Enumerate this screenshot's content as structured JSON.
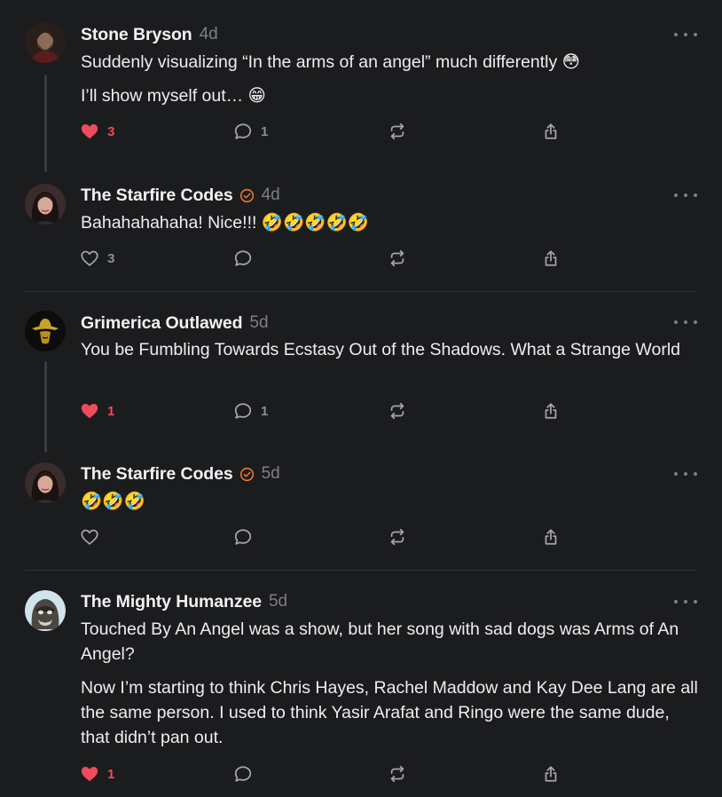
{
  "posts": [
    {
      "author": "Stone Bryson",
      "time": "4d",
      "verified": false,
      "paragraphs": [
        "Suddenly visualizing “In the arms of an angel” much differently 😳",
        "I’ll show myself out… 😁"
      ],
      "likes": "3",
      "liked": true,
      "comments": "1",
      "avatar_icon": "bearded-man-avatar"
    },
    {
      "author": "The Starfire Codes",
      "time": "4d",
      "verified": true,
      "paragraphs": [
        "Bahahahahaha! Nice!!! 🤣🤣🤣🤣🤣"
      ],
      "likes": "3",
      "liked": false,
      "comments": "",
      "avatar_icon": "woman-avatar"
    },
    {
      "author": "Grimerica Outlawed",
      "time": "5d",
      "verified": false,
      "paragraphs": [
        "You be Fumbling Towards Ecstasy Out of the Shadows. What a Strange World"
      ],
      "likes": "1",
      "liked": true,
      "comments": "1",
      "avatar_icon": "cowboy-hat-avatar"
    },
    {
      "author": "The Starfire Codes",
      "time": "5d",
      "verified": true,
      "paragraphs": [
        "🤣🤣🤣"
      ],
      "likes": "",
      "liked": false,
      "comments": "",
      "avatar_icon": "woman-avatar"
    },
    {
      "author": "The Mighty Humanzee",
      "time": "5d",
      "verified": false,
      "paragraphs": [
        "Touched By An Angel was a show, but her song with sad dogs was Arms of An Angel?",
        "Now I’m starting to think Chris Hayes, Rachel Maddow and Kay Dee Lang are all the same person. I used to think Yasir Arafat and Ringo were the same dude, that didn’t pan out."
      ],
      "likes": "1",
      "liked": true,
      "comments": "",
      "avatar_icon": "ape-mask-avatar"
    }
  ],
  "colors": {
    "background": "#1b1c1e",
    "like": "#ef4b5d",
    "verified": "#f2762e",
    "muted": "#7e7f84"
  }
}
